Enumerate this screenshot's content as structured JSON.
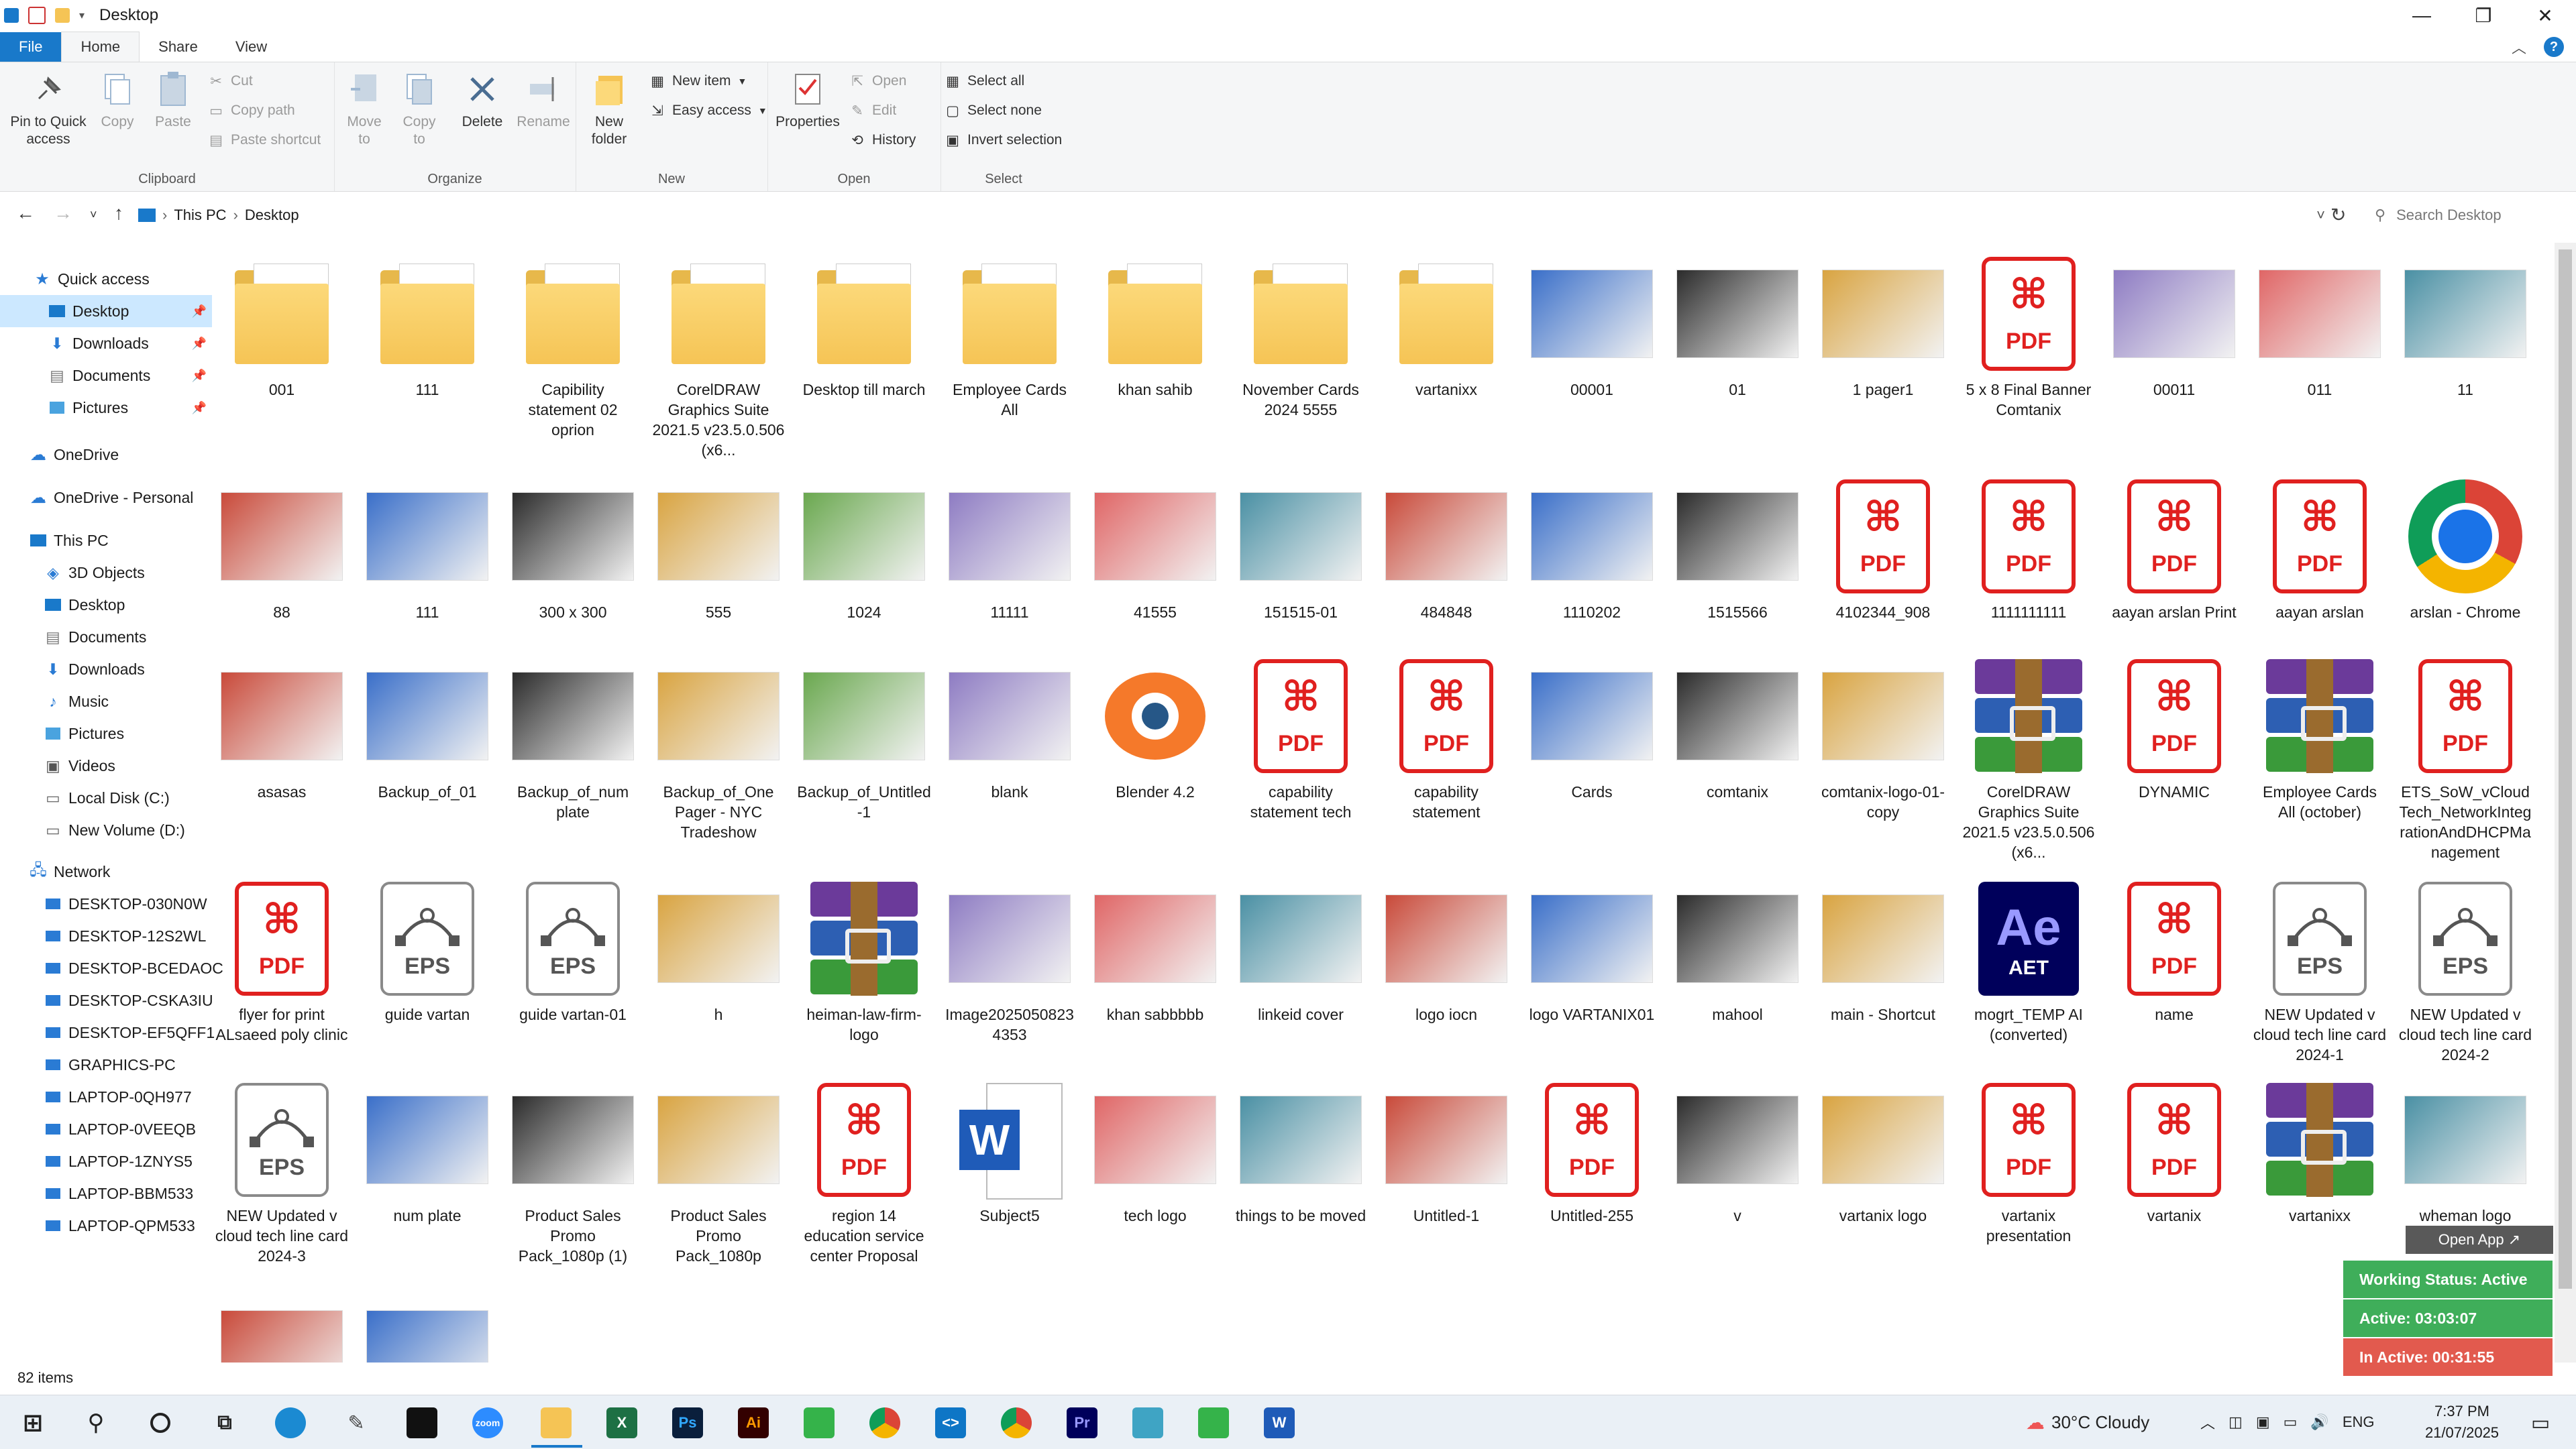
{
  "window": {
    "title": "Desktop"
  },
  "tabs": [
    "File",
    "Home",
    "Share",
    "View"
  ],
  "ribbon": {
    "clipboard": {
      "label": "Clipboard",
      "pin": "Pin to Quick access",
      "copy": "Copy",
      "paste": "Paste",
      "cut": "Cut",
      "copy_path": "Copy path",
      "paste_shortcut": "Paste shortcut"
    },
    "organize": {
      "label": "Organize",
      "move_to": "Move to",
      "copy_to": "Copy to",
      "delete": "Delete",
      "rename": "Rename"
    },
    "new": {
      "label": "New",
      "new_folder": "New folder",
      "new_item": "New item",
      "easy_access": "Easy access"
    },
    "open": {
      "label": "Open",
      "properties": "Properties",
      "open": "Open",
      "edit": "Edit",
      "history": "History"
    },
    "select": {
      "label": "Select",
      "select_all": "Select all",
      "select_none": "Select none",
      "invert": "Invert selection"
    }
  },
  "address": {
    "path1": "This PC",
    "path2": "Desktop",
    "search_placeholder": "Search Desktop"
  },
  "nav": {
    "quick_access": "Quick access",
    "quick_items": [
      "Desktop",
      "Downloads",
      "Documents",
      "Pictures"
    ],
    "onedrive": "OneDrive",
    "onedrive_personal": "OneDrive - Personal",
    "this_pc": "This PC",
    "pc_items": [
      "3D Objects",
      "Desktop",
      "Documents",
      "Downloads",
      "Music",
      "Pictures",
      "Videos",
      "Local Disk (C:)",
      "New Volume (D:)"
    ],
    "network": "Network",
    "network_items": [
      "DESKTOP-030N0W",
      "DESKTOP-12S2WL",
      "DESKTOP-BCEDAOC",
      "DESKTOP-CSKA3IU",
      "DESKTOP-EF5QFF1",
      "GRAPHICS-PC",
      "LAPTOP-0QH977",
      "LAPTOP-0VEEQB",
      "LAPTOP-1ZNYS5",
      "LAPTOP-BBM533",
      "LAPTOP-QPM533"
    ]
  },
  "files": [
    {
      "name": "001",
      "type": "folder"
    },
    {
      "name": "111",
      "type": "folder"
    },
    {
      "name": "Capibility statement 02 oprion",
      "type": "folder"
    },
    {
      "name": "CorelDRAW Graphics Suite 2021.5 v23.5.0.506 (x6...",
      "type": "folder"
    },
    {
      "name": "Desktop till march",
      "type": "folder"
    },
    {
      "name": "Employee Cards All",
      "type": "folder"
    },
    {
      "name": "khan sahib",
      "type": "folder"
    },
    {
      "name": "November Cards 2024 5555",
      "type": "folder"
    },
    {
      "name": "vartanixx",
      "type": "folder"
    },
    {
      "name": "00001",
      "type": "image"
    },
    {
      "name": "01",
      "type": "image"
    },
    {
      "name": "1 pager1",
      "type": "image"
    },
    {
      "name": "5 x 8 Final Banner Comtanix",
      "type": "pdf"
    },
    {
      "name": "00011",
      "type": "image"
    },
    {
      "name": "011",
      "type": "image"
    },
    {
      "name": "11",
      "type": "image"
    },
    {
      "name": "88",
      "type": "image"
    },
    {
      "name": "111",
      "type": "image"
    },
    {
      "name": "300 x 300",
      "type": "image"
    },
    {
      "name": "555",
      "type": "image"
    },
    {
      "name": "1024",
      "type": "image"
    },
    {
      "name": "11111",
      "type": "image"
    },
    {
      "name": "41555",
      "type": "image"
    },
    {
      "name": "151515-01",
      "type": "image"
    },
    {
      "name": "484848",
      "type": "image"
    },
    {
      "name": "1110202",
      "type": "image"
    },
    {
      "name": "1515566",
      "type": "image"
    },
    {
      "name": "4102344_908",
      "type": "pdf"
    },
    {
      "name": "1111111111",
      "type": "pdf"
    },
    {
      "name": "aayan arslan Print",
      "type": "pdf"
    },
    {
      "name": "aayan arslan",
      "type": "pdf"
    },
    {
      "name": "arslan - Chrome",
      "type": "chrome"
    },
    {
      "name": "asasas",
      "type": "image"
    },
    {
      "name": "Backup_of_01",
      "type": "image"
    },
    {
      "name": "Backup_of_num plate",
      "type": "image"
    },
    {
      "name": "Backup_of_One Pager - NYC Tradeshow",
      "type": "image"
    },
    {
      "name": "Backup_of_Untitled-1",
      "type": "image"
    },
    {
      "name": "blank",
      "type": "image"
    },
    {
      "name": "Blender 4.2",
      "type": "blender"
    },
    {
      "name": "capability statement tech",
      "type": "pdf"
    },
    {
      "name": "capability statement",
      "type": "pdf"
    },
    {
      "name": "Cards",
      "type": "image"
    },
    {
      "name": "comtanix",
      "type": "image"
    },
    {
      "name": "comtanix-logo-01-copy",
      "type": "image"
    },
    {
      "name": "CorelDRAW Graphics Suite 2021.5 v23.5.0.506 (x6...",
      "type": "rar"
    },
    {
      "name": "DYNAMIC",
      "type": "pdf"
    },
    {
      "name": "Employee Cards All (october)",
      "type": "rar"
    },
    {
      "name": "ETS_SoW_vCloudTech_NetworkIntegrationAndDHCPManagement",
      "type": "pdf"
    },
    {
      "name": "flyer for print ALsaeed poly clinic",
      "type": "pdf"
    },
    {
      "name": "guide vartan",
      "type": "eps"
    },
    {
      "name": "guide vartan-01",
      "type": "eps"
    },
    {
      "name": "h",
      "type": "image"
    },
    {
      "name": "heiman-law-firm-logo",
      "type": "rar"
    },
    {
      "name": "Image2025050823 4353",
      "type": "image"
    },
    {
      "name": "khan sabbbbb",
      "type": "image"
    },
    {
      "name": "linkeid cover",
      "type": "image"
    },
    {
      "name": "logo iocn",
      "type": "image"
    },
    {
      "name": "logo VARTANIX01",
      "type": "image"
    },
    {
      "name": "mahool",
      "type": "image"
    },
    {
      "name": "main - Shortcut",
      "type": "image"
    },
    {
      "name": "mogrt_TEMP AI (converted)",
      "type": "ae"
    },
    {
      "name": "name",
      "type": "pdf"
    },
    {
      "name": "NEW Updated v cloud tech line card 2024-1",
      "type": "eps"
    },
    {
      "name": "NEW Updated v cloud tech line card 2024-2",
      "type": "eps"
    },
    {
      "name": "NEW Updated v cloud tech line card 2024-3",
      "type": "eps"
    },
    {
      "name": "num plate",
      "type": "image"
    },
    {
      "name": "Product Sales Promo Pack_1080p (1)",
      "type": "image"
    },
    {
      "name": "Product Sales Promo Pack_1080p",
      "type": "image"
    },
    {
      "name": "region 14 education service center Proposal",
      "type": "pdf"
    },
    {
      "name": "Subject5",
      "type": "word"
    },
    {
      "name": "tech logo",
      "type": "image"
    },
    {
      "name": "things to be moved",
      "type": "image"
    },
    {
      "name": "Untitled-1",
      "type": "image"
    },
    {
      "name": "Untitled-255",
      "type": "pdf"
    },
    {
      "name": "v",
      "type": "image"
    },
    {
      "name": "vartanix logo",
      "type": "image"
    },
    {
      "name": "vartanix presentation",
      "type": "pdf"
    },
    {
      "name": "vartanix",
      "type": "pdf"
    },
    {
      "name": "vartanixx",
      "type": "rar"
    },
    {
      "name": "wheman logo",
      "type": "image"
    },
    {
      "name": "",
      "type": "image"
    },
    {
      "name": "",
      "type": "image"
    }
  ],
  "status": {
    "count": "82 items"
  },
  "widget": {
    "open_app": "Open App ↗",
    "working": "Working Status: Active",
    "active": "Active: 03:03:07",
    "inactive": "In Active: 00:31:55"
  },
  "taskbar": {
    "weather": "30°C Cloudy",
    "lang": "ENG",
    "time": "7:37 PM",
    "date": "21/07/2025"
  }
}
